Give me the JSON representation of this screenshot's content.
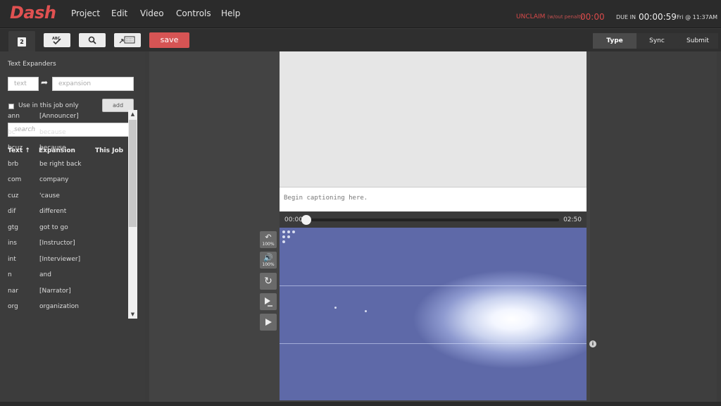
{
  "app": {
    "logo": "Dash"
  },
  "menu": [
    "Project",
    "Edit",
    "Video",
    "Controls",
    "Help"
  ],
  "status": {
    "unclaim_label": "UNCLAIM",
    "unclaim_sub": "(w/out penalty)",
    "unclaim_time": "00:00",
    "due_label": "DUE IN",
    "due_time": "00:00:59",
    "due_date": "Fri @ 11:37AM"
  },
  "toolbar": {
    "save_label": "save",
    "spell_label": "ABC"
  },
  "steps": [
    "Type",
    "Sync",
    "Submit"
  ],
  "expanders": {
    "title": "Text Expanders",
    "text_placeholder": "text",
    "expansion_placeholder": "expansion",
    "checkbox_label": "Use in this job only",
    "add_label": "add",
    "search_placeholder": "search",
    "col_text": "Text ↑",
    "col_expansion": "Expansion",
    "col_this_job": "This Job",
    "rows": [
      {
        "text": "ann",
        "expansion": "[Announcer]"
      },
      {
        "text": "bc",
        "expansion": "because"
      },
      {
        "text": "bcuz",
        "expansion": "because"
      },
      {
        "text": "brb",
        "expansion": "be right back"
      },
      {
        "text": "com",
        "expansion": "company"
      },
      {
        "text": "cuz",
        "expansion": "'cause"
      },
      {
        "text": "dif",
        "expansion": "different"
      },
      {
        "text": "gtg",
        "expansion": "got to go"
      },
      {
        "text": "ins",
        "expansion": "[Instructor]"
      },
      {
        "text": "int",
        "expansion": "[Interviewer]"
      },
      {
        "text": "n",
        "expansion": "and"
      },
      {
        "text": "nar",
        "expansion": "[Narrator]"
      },
      {
        "text": "org",
        "expansion": "organization"
      }
    ]
  },
  "editor": {
    "placeholder": "Begin captioning here."
  },
  "player": {
    "current_time": "00:00",
    "duration": "02:50",
    "progress": 0,
    "rewind_rate": "100%",
    "volume": "100%"
  },
  "colors": {
    "accent": "#d65454",
    "brand": "#e05151"
  }
}
